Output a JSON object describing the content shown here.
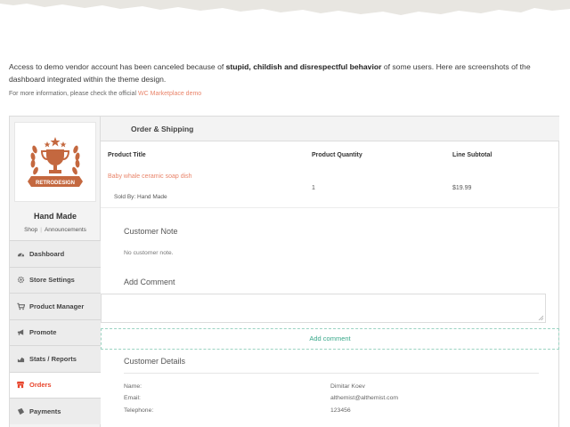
{
  "notice": {
    "part1": "Access to demo vendor account has been canceled because of ",
    "bold": "stupid,  childish and disrespectful behavior",
    "part2": " of some users. Here are screenshots of the dashboard integrated within the theme design."
  },
  "info": {
    "text": "For more information, please check the official ",
    "link": "WC Marketplace demo"
  },
  "sidebar": {
    "store_name": "Hand Made",
    "links": [
      "Shop",
      "Announcements"
    ],
    "menu": [
      {
        "label": "Dashboard",
        "icon": "dashboard-icon"
      },
      {
        "label": "Store Settings",
        "icon": "gear-icon"
      },
      {
        "label": "Product Manager",
        "icon": "cart-icon"
      },
      {
        "label": "Promote",
        "icon": "megaphone-icon"
      },
      {
        "label": "Stats / Reports",
        "icon": "chart-icon"
      },
      {
        "label": "Orders",
        "icon": "store-icon",
        "active": true
      },
      {
        "label": "Payments",
        "icon": "payments-icon"
      }
    ]
  },
  "order": {
    "section_title": "Order & Shipping",
    "columns": [
      "Product Title",
      "Product Quantity",
      "Line Subtotal"
    ],
    "product": {
      "title": "Baby whale ceramic soap dish",
      "sold_by": "Sold By: Hand Made",
      "quantity": "1",
      "subtotal": "$19.99"
    }
  },
  "customer_note": {
    "title": "Customer Note",
    "text": "No customer note."
  },
  "add_comment": {
    "title": "Add Comment",
    "button": "Add comment",
    "placeholder": ""
  },
  "customer_details": {
    "title": "Customer Details",
    "rows": [
      {
        "label": "Name:",
        "value": "Dimitar Koev"
      },
      {
        "label": "Email:",
        "value": "althemist@althemist.com"
      },
      {
        "label": "Telephone:",
        "value": "123456"
      }
    ]
  },
  "colors": {
    "accent": "#e8452c",
    "link": "#e9846a",
    "comment_button": "#38a88a",
    "logo": "#c4683f"
  }
}
